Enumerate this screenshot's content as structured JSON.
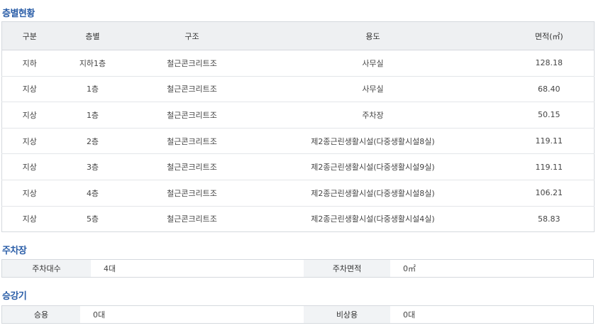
{
  "floors": {
    "title": "층별현황",
    "headers": [
      "구분",
      "층별",
      "구조",
      "용도",
      "면적(㎡)"
    ],
    "rows": [
      [
        "지하",
        "지하1층",
        "철근콘크리트조",
        "사무실",
        "128.18"
      ],
      [
        "지상",
        "1층",
        "철근콘크리트조",
        "사무실",
        "68.40"
      ],
      [
        "지상",
        "1층",
        "철근콘크리트조",
        "주차장",
        "50.15"
      ],
      [
        "지상",
        "2층",
        "철근콘크리트조",
        "제2종근린생활시설(다중생활시설8실)",
        "119.11"
      ],
      [
        "지상",
        "3층",
        "철근콘크리트조",
        "제2종근린생활시설(다중생활시설9실)",
        "119.11"
      ],
      [
        "지상",
        "4층",
        "철근콘크리트조",
        "제2종근린생활시설(다중생활시설8실)",
        "106.21"
      ],
      [
        "지상",
        "5층",
        "철근콘크리트조",
        "제2종근린생활시설(다중생활시설4실)",
        "58.83"
      ]
    ]
  },
  "parking": {
    "title": "주차장",
    "count_label": "주차대수",
    "count_value": "4대",
    "area_label": "주차면적",
    "area_value": "0㎡"
  },
  "elevator": {
    "title": "승강기",
    "passenger_label": "승용",
    "passenger_value": "0대",
    "emergency_label": "비상용",
    "emergency_value": "0대"
  }
}
